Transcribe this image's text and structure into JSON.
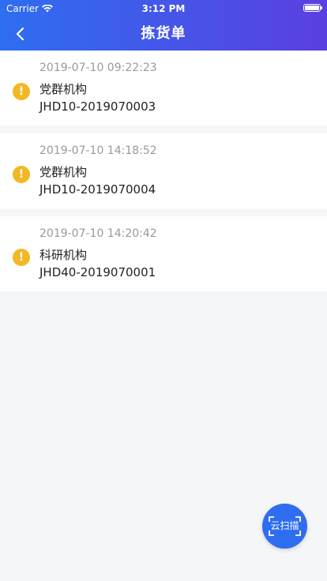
{
  "status_bar": {
    "carrier": "Carrier",
    "time": "3:12 PM"
  },
  "header": {
    "title": "拣货单"
  },
  "orders": [
    {
      "datetime": "2019-07-10 09:22:23",
      "organization": "党群机构",
      "code": "JHD10-2019070003"
    },
    {
      "datetime": "2019-07-10 14:18:52",
      "organization": "党群机构",
      "code": "JHD10-2019070004"
    },
    {
      "datetime": "2019-07-10 14:20:42",
      "organization": "科研机构",
      "code": "JHD40-2019070001"
    }
  ],
  "warning_glyph": "!",
  "scan_button": {
    "label": "云扫描"
  },
  "colors": {
    "header_start": "#2e6ef0",
    "header_end": "#5a3fe0",
    "warning": "#f2b824",
    "scan_button": "#2f6df0"
  }
}
